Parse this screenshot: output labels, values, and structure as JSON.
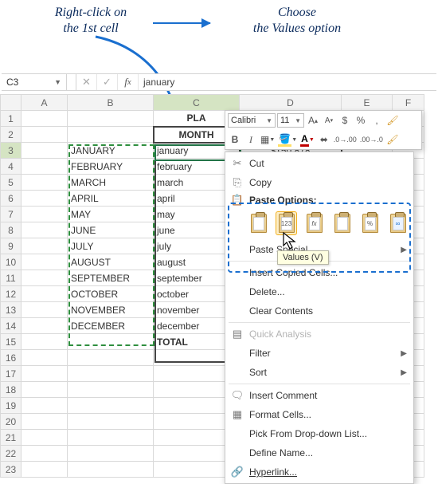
{
  "annotations": {
    "left": "Right-click on\nthe 1st cell",
    "right": "Choose\nthe Values option"
  },
  "namebox": "C3",
  "formula": "january",
  "headers": {
    "c1": "A",
    "c2": "B",
    "c3": "C",
    "c4": "D",
    "c5": "E",
    "c6": "F"
  },
  "rows": [
    "1",
    "2",
    "3",
    "4",
    "5",
    "6",
    "7",
    "8",
    "9",
    "10",
    "11",
    "12",
    "13",
    "14",
    "15",
    "16",
    "17",
    "18",
    "19",
    "20",
    "21",
    "22",
    "23"
  ],
  "plan_title": "PLA",
  "month_header": "MONTH",
  "total_label": "TOTAL",
  "amount": "$150,878",
  "months_upper": [
    "JANUARY",
    "FEBRUARY",
    "MARCH",
    "APRIL",
    "MAY",
    "JUNE",
    "JULY",
    "AUGUST",
    "SEPTEMBER",
    "OCTOBER",
    "NOVEMBER",
    "DECEMBER"
  ],
  "months_lower": [
    "january",
    "february",
    "march",
    "april",
    "may",
    "june",
    "july",
    "august",
    "september",
    "october",
    "november",
    "december"
  ],
  "mini": {
    "font": "Calibri",
    "size": "11",
    "bold": "B",
    "italic": "I",
    "incA": "A",
    "decA": "A",
    "dollar": "$",
    "percent": "%",
    "comma": ","
  },
  "ctx": {
    "cut": "Cut",
    "copy": "Copy",
    "paste_options": "Paste Options:",
    "paste_special": "Paste Special...",
    "insert_copied": "Insert Copied Cells...",
    "delete": "Delete...",
    "clear": "Clear Contents",
    "quick": "Quick Analysis",
    "filter": "Filter",
    "sort": "Sort",
    "comment": "Insert Comment",
    "format": "Format Cells...",
    "pick": "Pick From Drop-down List...",
    "define": "Define Name...",
    "hyper": "Hyperlink..."
  },
  "tooltip": "Values (V)",
  "paste_badges": {
    "p1": "",
    "p2": "123",
    "p3": "fx",
    "p4": "",
    "p5": "%",
    "p6": "∞"
  },
  "chart_data": null
}
